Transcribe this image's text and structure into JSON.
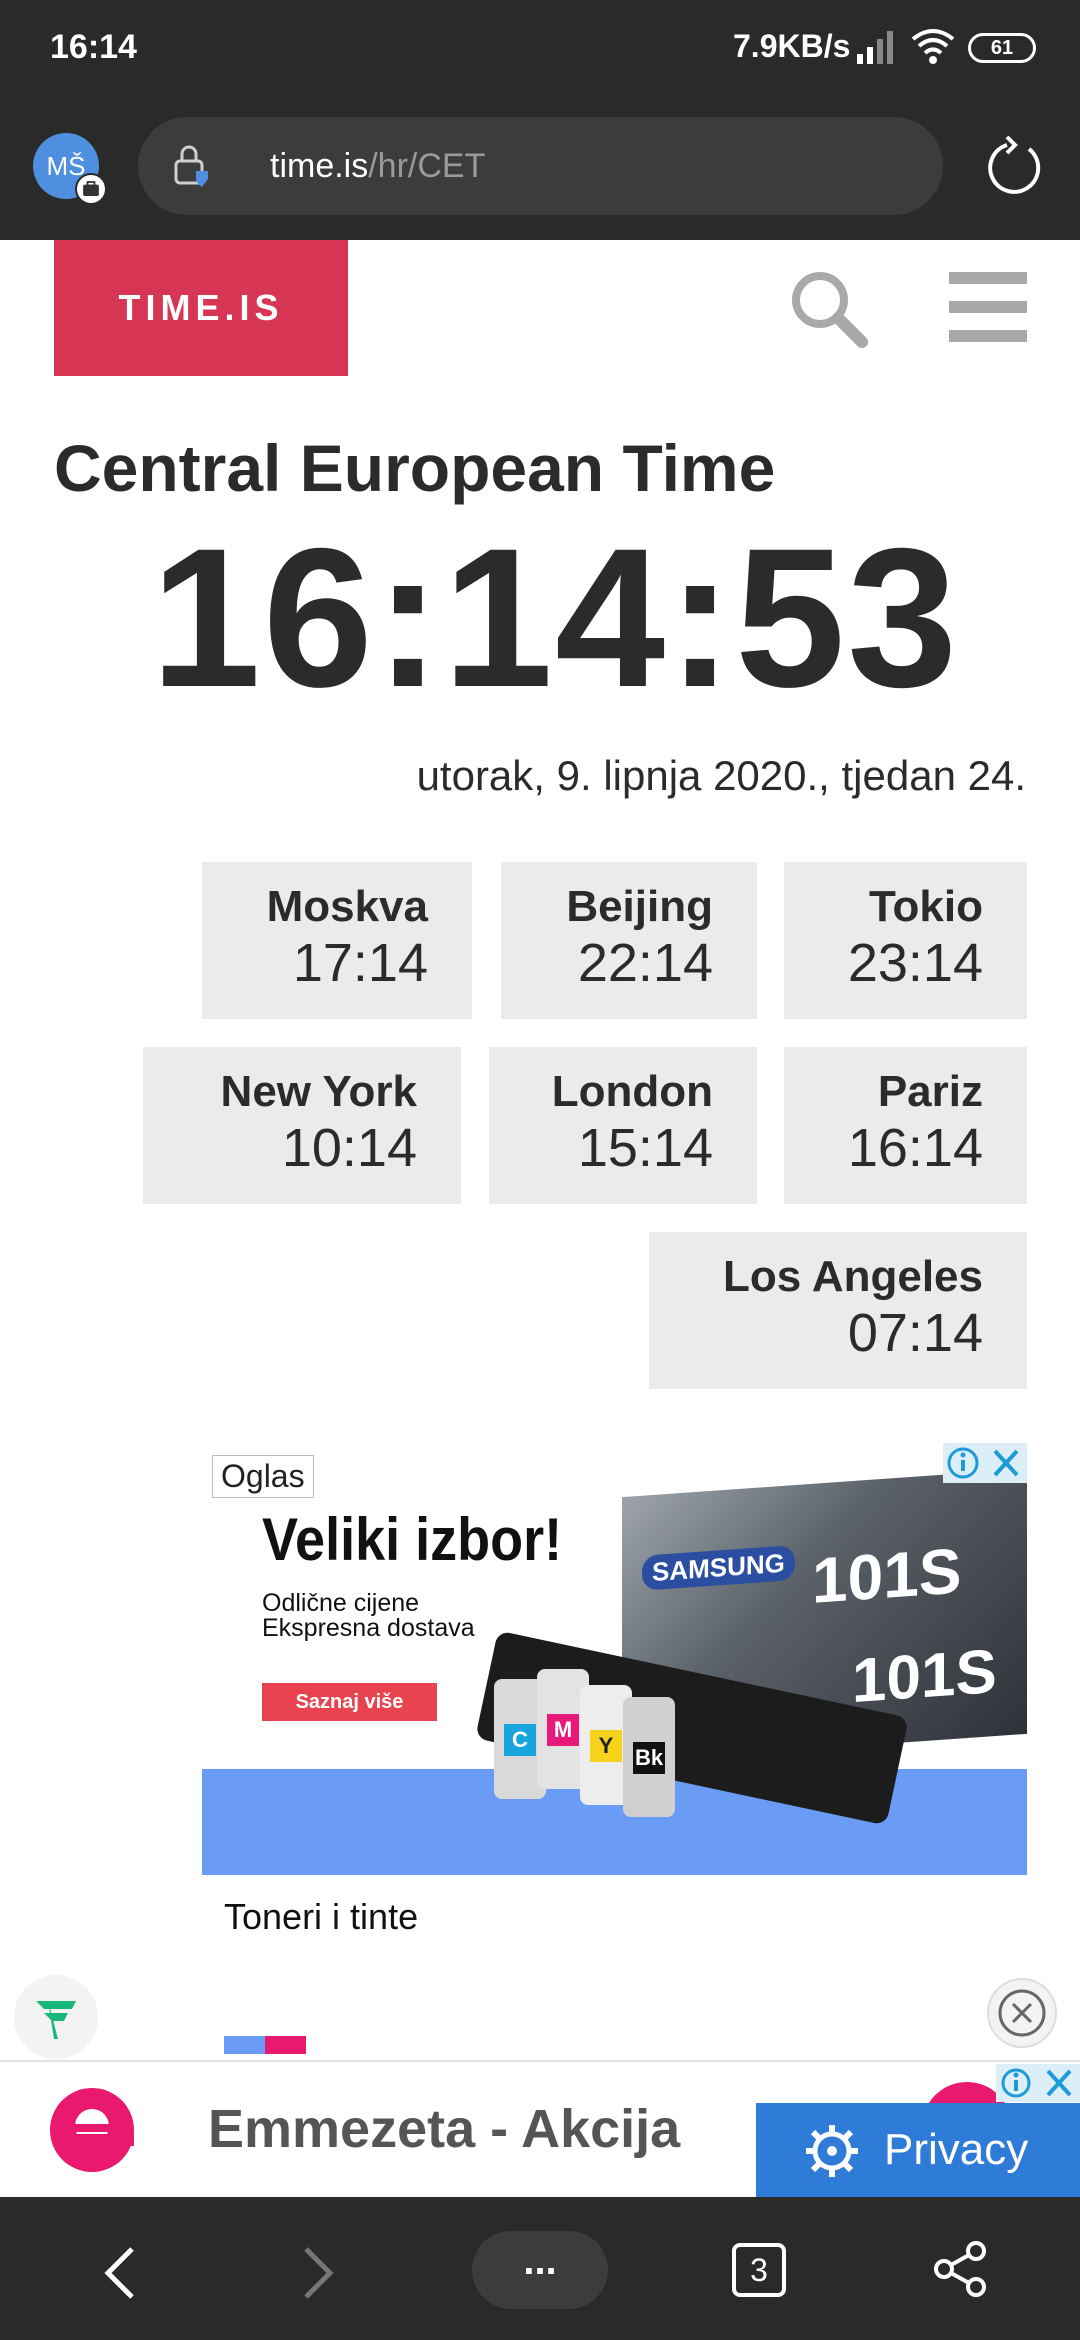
{
  "status_bar": {
    "time": "16:14",
    "network_speed": "7.9KB/s",
    "battery": "61"
  },
  "browser": {
    "avatar_initials": "MŠ",
    "url_host": "time.is",
    "url_path": "/hr/CET",
    "tab_count": "3",
    "more_label": "..."
  },
  "site": {
    "logo": "TIME.IS",
    "title": "Central European Time",
    "clock": "16:14:53",
    "date": "utorak, 9. lipnja 2020., tjedan 24.",
    "brand_color": "#d73554"
  },
  "cities": [
    {
      "name": "Moskva",
      "time": "17:14"
    },
    {
      "name": "Beijing",
      "time": "22:14"
    },
    {
      "name": "Tokio",
      "time": "23:14"
    },
    {
      "name": "New York",
      "time": "10:14"
    },
    {
      "name": "London",
      "time": "15:14"
    },
    {
      "name": "Pariz",
      "time": "16:14"
    },
    {
      "name": "Los Angeles",
      "time": "07:14"
    }
  ],
  "ad": {
    "label": "Oglas",
    "headline": "Veliki izbor!",
    "line1": "Odlične cijene",
    "line2": "Ekspresna dostava",
    "cta": "Saznaj više",
    "box_brand": "SAMSUNG",
    "box_model": "101S",
    "bottles": [
      "C",
      "M",
      "Y",
      "Bk"
    ],
    "caption": "Toneri i tinte"
  },
  "banner": {
    "logo_letter": "e",
    "text": "Emmezeta - Akcija",
    "privacy_label": "Privacy"
  }
}
